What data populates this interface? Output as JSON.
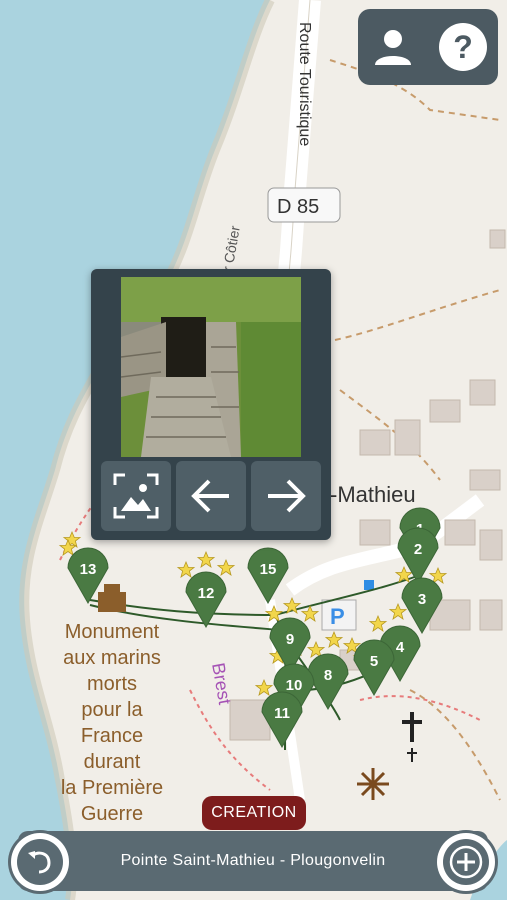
{
  "map": {
    "road_name": "Route Touristique",
    "road_badge": "D 85",
    "coastal_label": "r Côtier",
    "place_label": "-Mathieu",
    "town_label": "Brest",
    "monument_lines": [
      "Monument",
      "aux marins",
      "morts",
      "pour la",
      "France",
      "durant",
      "la Première",
      "Guerre"
    ],
    "markers": [
      "1",
      "2",
      "3",
      "4",
      "5",
      "8",
      "9",
      "10",
      "11",
      "12",
      "13",
      "15"
    ],
    "parking_label": "P"
  },
  "header": {
    "profile_icon": "person-icon",
    "help_icon": "question-icon"
  },
  "gallery": {
    "fullscreen_icon": "image-frame-icon",
    "prev_icon": "arrow-left-icon",
    "next_icon": "arrow-right-icon"
  },
  "creation_badge": "CREATION",
  "bottom": {
    "title": "Pointe Saint-Mathieu - Plougonvelin",
    "back_icon": "undo-icon",
    "add_icon": "plus-icon"
  },
  "colors": {
    "sea": "#aad3df",
    "marker": "#4a7a43",
    "panel": "#34434b",
    "bar": "#5a6a72",
    "creation": "#7d1c1c"
  }
}
